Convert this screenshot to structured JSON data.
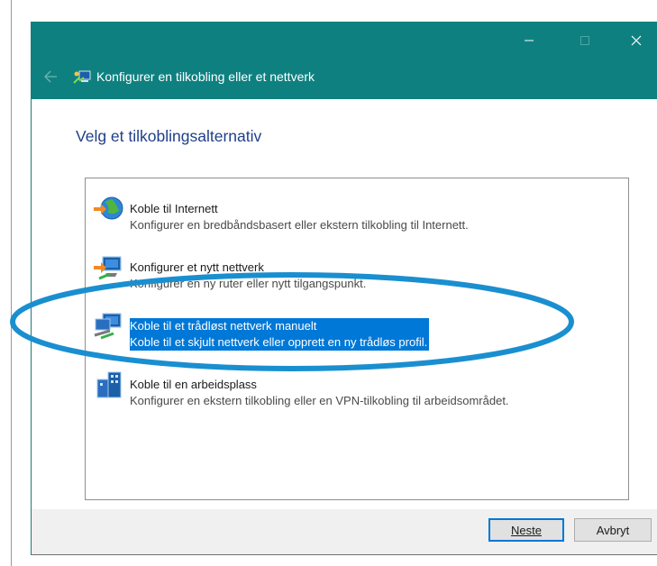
{
  "window": {
    "title": "Konfigurer en tilkobling eller et nettverk",
    "heading": "Velg et tilkoblingsalternativ"
  },
  "options": [
    {
      "title": "Koble til Internett",
      "description": "Konfigurer en bredbåndsbasert eller ekstern tilkobling til Internett.",
      "icon": "globe-network-icon",
      "selected": false
    },
    {
      "title": "Konfigurer et nytt nettverk",
      "description": "Konfigurer en ny ruter eller nytt tilgangspunkt.",
      "icon": "router-network-icon",
      "selected": false
    },
    {
      "title": "Koble til et trådløst nettverk manuelt",
      "description": "Koble til et skjult nettverk eller opprett en ny trådløs profil.",
      "icon": "wireless-network-icon",
      "selected": true
    },
    {
      "title": "Koble til en arbeidsplass",
      "description": "Konfigurer en ekstern tilkobling eller en VPN-tilkobling til arbeidsområdet.",
      "icon": "workplace-building-icon",
      "selected": false
    }
  ],
  "buttons": {
    "next_label": "Neste",
    "cancel_label": "Avbryt"
  },
  "colors": {
    "titlebar": "#0f8080",
    "heading": "#1e3f8a",
    "selection": "#0078d7",
    "annotation": "#1a8fd0"
  }
}
